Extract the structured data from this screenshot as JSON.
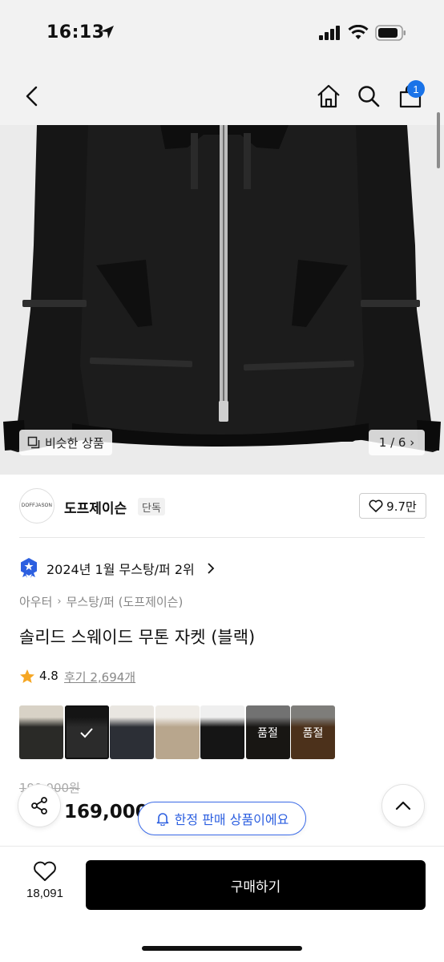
{
  "status_bar": {
    "time": "16:13"
  },
  "header": {
    "cart_count": "1"
  },
  "gallery": {
    "similar_label": "비슷한 상품",
    "page_indicator": "1 / 6 ›"
  },
  "brand": {
    "logo_text": "DOFFJASON",
    "name": "도프제이슨",
    "tag": "단독",
    "likes": "9.7만"
  },
  "ranking": {
    "text": "2024년 1월 무스탕/퍼 2위"
  },
  "breadcrumb": [
    "아우터",
    "무스탕/퍼 (도프제이슨)"
  ],
  "product": {
    "title": "솔리드 스웨이드 무톤 자켓 (블랙)",
    "rating": "4.8",
    "reviews": "후기 2,694개",
    "original_price": "199,000원",
    "price": "169,000"
  },
  "swatches": [
    {
      "name": "swatch-1",
      "colors": [
        "#d8d2c6",
        "#2a2a27"
      ],
      "soldout": ""
    },
    {
      "name": "swatch-2",
      "colors": [
        "#141414",
        "#2b2b2b"
      ],
      "soldout": "",
      "selected": true
    },
    {
      "name": "swatch-3",
      "colors": [
        "#e9e6e1",
        "#2c2f36"
      ],
      "soldout": ""
    },
    {
      "name": "swatch-4",
      "colors": [
        "#efece7",
        "#b8a68d"
      ],
      "soldout": ""
    },
    {
      "name": "swatch-5",
      "colors": [
        "#efefef",
        "#151515"
      ],
      "soldout": ""
    },
    {
      "name": "swatch-6",
      "colors": [
        "#cfcfcf",
        "#2c2824"
      ],
      "soldout": "품절"
    },
    {
      "name": "swatch-7",
      "colors": [
        "#e6e3de",
        "#8b5a32"
      ],
      "soldout": "품절"
    }
  ],
  "limited_notice": "한정 판매 상품이에요",
  "bottom": {
    "wish_count": "18,091",
    "buy_label": "구매하기"
  },
  "colors": {
    "accent_blue": "#2c5fe0",
    "badge_blue": "#1a73e8",
    "buy_black": "#000000"
  }
}
